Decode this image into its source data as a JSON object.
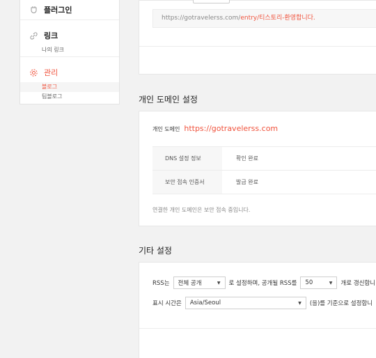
{
  "sidebar": {
    "plugin": {
      "label": "플러그인",
      "icon": "plugin-icon"
    },
    "link": {
      "label": "링크",
      "icon": "link-icon",
      "sub": "나의 링크"
    },
    "manage": {
      "label": "관리",
      "icon": "gear-icon",
      "subs": [
        "블로그",
        "팀블로그"
      ]
    }
  },
  "top": {
    "url_prefix": "https://gotravelerss.com/",
    "url_highlight": "entry/티스토리-환영합니다."
  },
  "domain": {
    "title": "개인 도메인 설정",
    "label": "개인 도메인",
    "value": "https://gotravelerss.com",
    "rows": [
      {
        "key": "DNS 설정 정보",
        "val": "확인 완료"
      },
      {
        "key": "보안 접속 인증서",
        "val": "발급 완료"
      }
    ],
    "note": "연결한 개인 도메인은 보안 접속 중입니다."
  },
  "etc": {
    "title": "기타 설정",
    "rss_prefix": "RSS는",
    "rss_select": "전체 공개",
    "rss_middle": "로 설정하며, 공개될 RSS를",
    "rss_count": "50",
    "rss_suffix": "개로 갱신합니",
    "time_prefix": "표시 시간은",
    "time_select": "Asia/Seoul",
    "time_suffix": "(을)를 기준으로 설정합니"
  },
  "colors": {
    "accent": "#f0533d"
  }
}
